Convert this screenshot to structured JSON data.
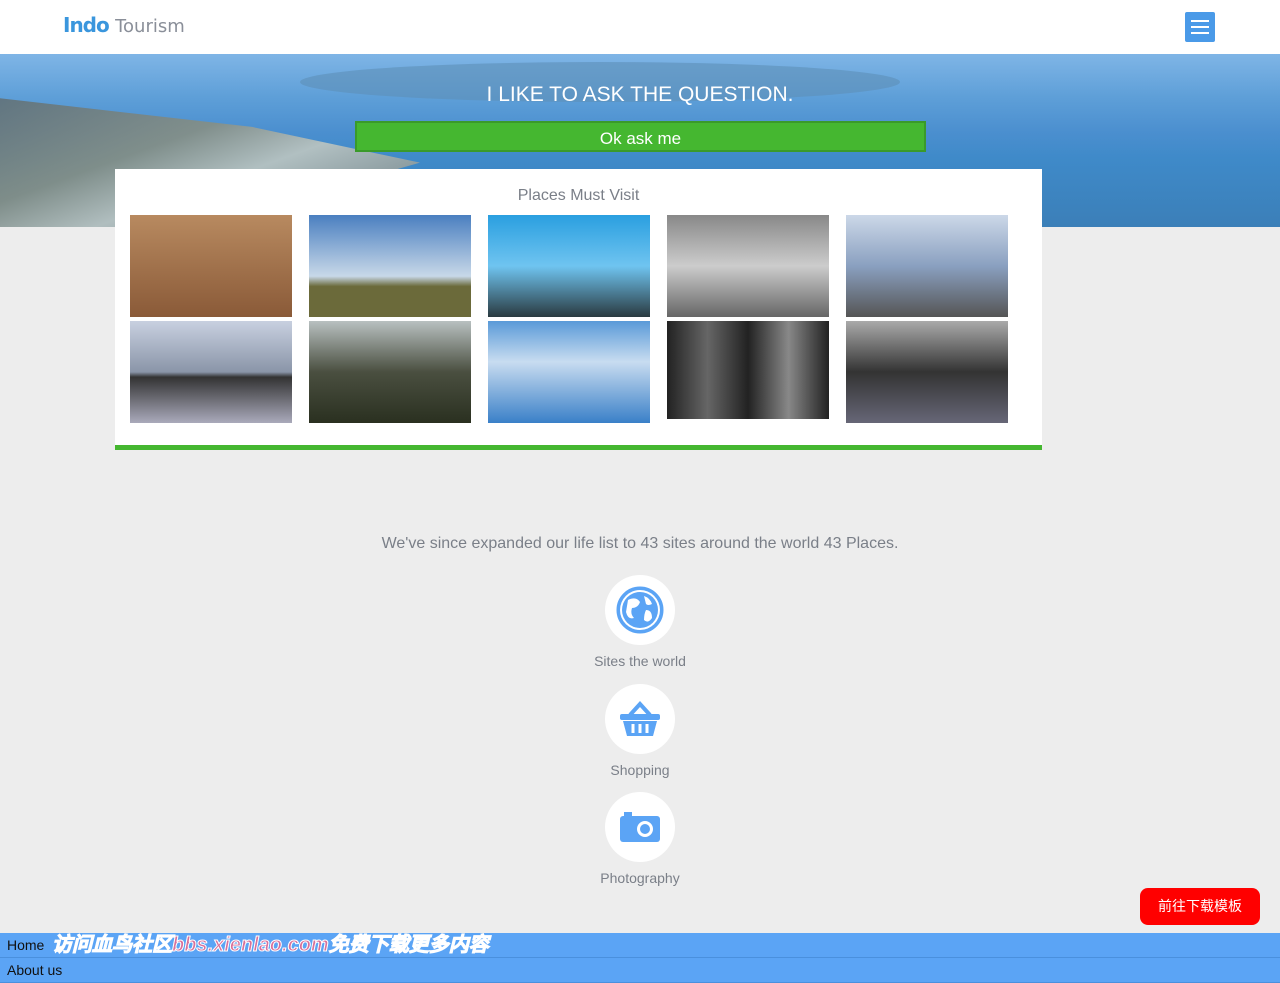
{
  "header": {
    "logo_bold": "Indo",
    "logo_light": "Tourism",
    "menu_icon": "hamburger-icon"
  },
  "hero": {
    "title": "I LIKE TO ASK THE QUESTION.",
    "button": "Ok ask me"
  },
  "places": {
    "title": "Places Must Visit",
    "photos": [
      "sunset-boat",
      "hill-path",
      "mountain-sky",
      "stone-carving",
      "rocky-shore",
      "lake-reflection",
      "forest-hillside",
      "coastline",
      "pine-forest",
      "forest-pond"
    ]
  },
  "stats": {
    "text": "We've since expanded our life list to 43 sites around the world 43 Places."
  },
  "features": [
    {
      "label": "Sites the world",
      "icon": "globe-icon"
    },
    {
      "label": "Shopping",
      "icon": "basket-icon"
    },
    {
      "label": "Photography",
      "icon": "camera-icon"
    }
  ],
  "download_button": "前往下载模板",
  "nav": {
    "items": [
      "Home",
      "About us"
    ]
  },
  "watermark": "访问血鸟社区bbs.xienlao.com免费下载更多内容",
  "colors": {
    "accent_green": "#45b730",
    "brand_blue": "#5ba4f5",
    "download_red": "#ff0000"
  }
}
